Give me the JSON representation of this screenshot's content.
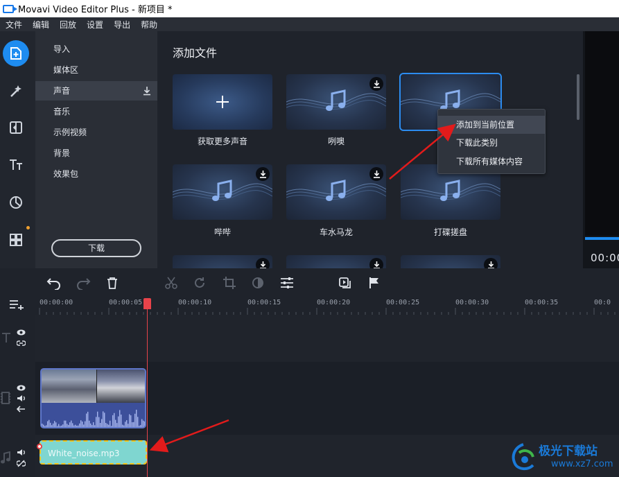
{
  "window": {
    "title": "Movavi Video Editor Plus - 新项目 *"
  },
  "menu": [
    "文件",
    "编辑",
    "回放",
    "设置",
    "导出",
    "帮助"
  ],
  "rail": {
    "icons": [
      "add-files-icon",
      "magic-wand-icon",
      "transitions-icon",
      "titles-icon",
      "filters-icon",
      "more-tools-icon"
    ]
  },
  "categories": {
    "items": [
      "导入",
      "媒体区",
      "声音",
      "音乐",
      "示例视频",
      "背景",
      "效果包"
    ],
    "selected": "声音",
    "download_label": "下载"
  },
  "content": {
    "title": "添加文件",
    "tiles": [
      "获取更多声音",
      "咧噢",
      "",
      "哔哔",
      "车水马龙",
      "打碟搓盘",
      "",
      "",
      ""
    ]
  },
  "context_menu": [
    "添加到当前位置",
    "下载此类别",
    "下载所有媒体内容"
  ],
  "preview": {
    "time": "00:00"
  },
  "timeline": {
    "ticks": [
      "00:00:00",
      "00:00:05",
      "00:00:10",
      "00:00:15",
      "00:00:20",
      "00:00:25",
      "00:00:30",
      "00:00:35",
      "00:0"
    ],
    "audio_clip": "White_noise.mp3"
  },
  "watermark": {
    "title": "极光下载站",
    "url": "www.xz7.com"
  },
  "colors": {
    "accent": "#1e8cf0",
    "playhead": "#e8434a",
    "audio_clip": "#7fd6d0",
    "arrow": "#e21b1b"
  }
}
